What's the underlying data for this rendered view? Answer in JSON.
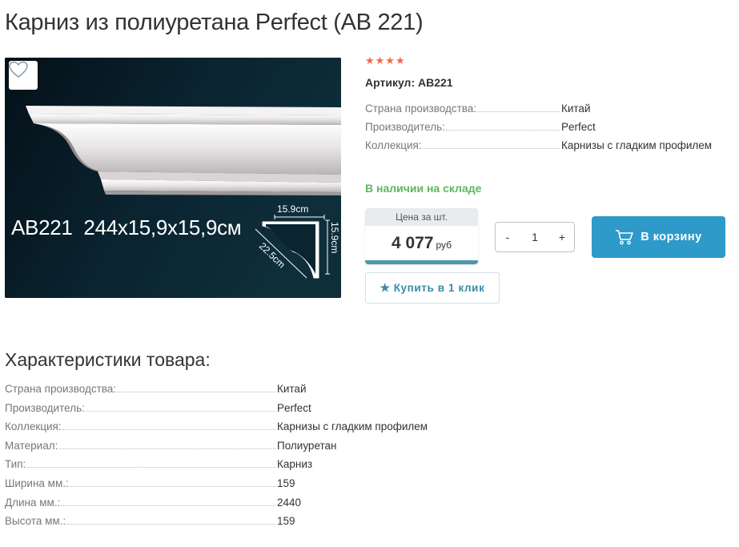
{
  "product": {
    "title": "Карниз из полиуретана Perfect (AB 221)",
    "rating_stars": "★★★★",
    "sku_text": "Артикул: AB221",
    "image": {
      "caption": "AB221  244x15,9x15,9см",
      "dim_top": "15.9cm",
      "dim_right": "15.9cm",
      "dim_diag": "22.5cm"
    },
    "favorite_icon": "heart-icon"
  },
  "summary_specs": [
    {
      "label": "Страна производства:",
      "value": "Китай"
    },
    {
      "label": "Производитель:",
      "value": "Perfect"
    },
    {
      "label": "Коллекция:",
      "value": "Карнизы с гладким профилем"
    }
  ],
  "stock_status": "В наличии на складе",
  "price": {
    "label": "Цена за шт.",
    "value": "4 077",
    "currency": "руб"
  },
  "quantity": {
    "minus": "-",
    "value": "1",
    "plus": "+"
  },
  "buttons": {
    "cart": "В корзину",
    "cart_icon": "cart-icon",
    "one_click": "Купить в 1 клик",
    "one_click_icon": "star-icon"
  },
  "characteristics": {
    "title": "Характеристики товара:",
    "rows": [
      {
        "label": "Страна производства:",
        "value": "Китай"
      },
      {
        "label": "Производитель:",
        "value": "Perfect"
      },
      {
        "label": "Коллекция:",
        "value": "Карнизы с гладким профилем"
      },
      {
        "label": "Материал:",
        "value": "Полиуретан"
      },
      {
        "label": "Тип:",
        "value": "Карниз"
      },
      {
        "label": "Ширина мм.:",
        "value": "159"
      },
      {
        "label": "Длина мм.:",
        "value": "2440"
      },
      {
        "label": "Высота мм.:",
        "value": "159"
      }
    ]
  },
  "colors": {
    "accent": "#2e9ac9",
    "stock_green": "#5cb85c",
    "rating": "#f06a4b",
    "price_bar": "#4d98ad"
  }
}
